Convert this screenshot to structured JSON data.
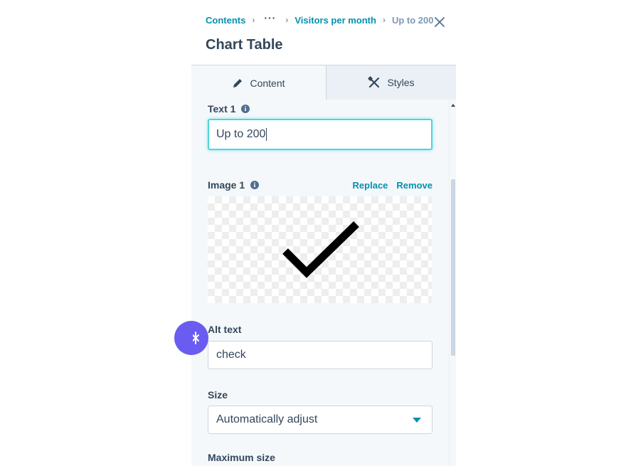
{
  "breadcrumb": {
    "root": "Contents",
    "ellipsis": "···",
    "parent": "Visitors per month",
    "current": "Up to 200",
    "separator": "›"
  },
  "header": {
    "title": "Chart Table"
  },
  "tabs": [
    {
      "label": "Content",
      "icon": "pencil-icon",
      "active": true
    },
    {
      "label": "Styles",
      "icon": "brush-icon",
      "active": false
    }
  ],
  "fields": {
    "text1": {
      "label": "Text 1",
      "value": "Up to 200"
    },
    "image1": {
      "label": "Image 1",
      "replace_label": "Replace",
      "remove_label": "Remove",
      "image_icon": "checkmark-image"
    },
    "alt_text": {
      "label": "Alt text",
      "value": "check"
    },
    "size": {
      "label": "Size",
      "selected": "Automatically adjust"
    },
    "max_size": {
      "label": "Maximum size"
    }
  },
  "colors": {
    "link": "#0091ae",
    "text": "#33475b",
    "focus": "#51d3d9",
    "fab": "#6a5cf0"
  }
}
